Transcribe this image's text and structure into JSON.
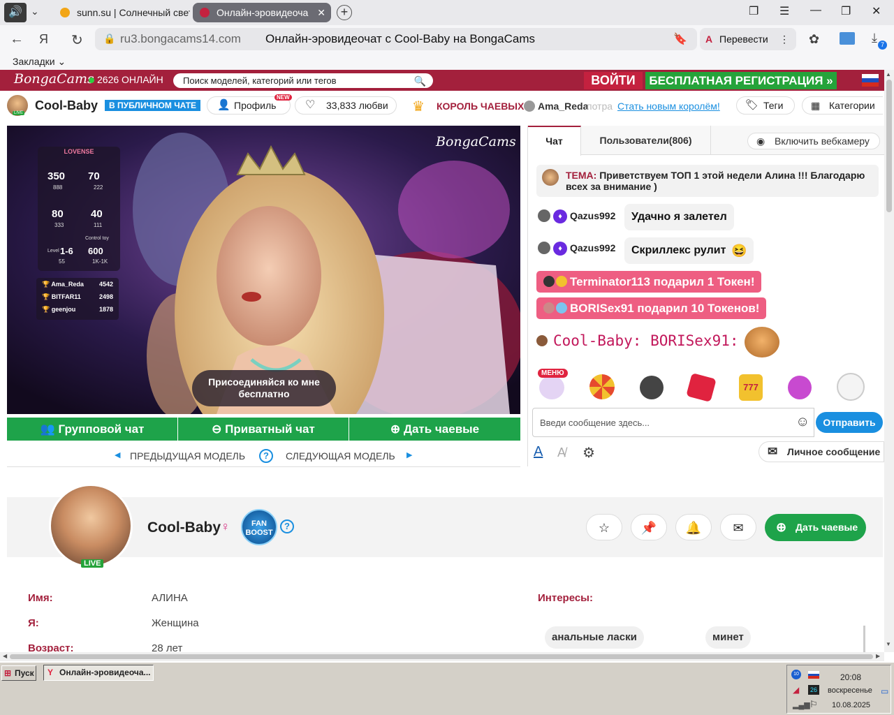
{
  "browser": {
    "tabs": [
      {
        "title": "sunn.su | Солнечный свет",
        "active": false
      },
      {
        "title": "Онлайн-эровидеоча",
        "active": true
      }
    ],
    "host": "ru3.bongacams14.com",
    "page_title": "Онлайн-эровидеочат с Cool-Baby на BongaCams",
    "translate_label": "Перевести",
    "bookmarks_label": "Закладки",
    "downloads_badge": "7"
  },
  "header": {
    "logo": "BongaCams",
    "online_text": "2626 ОНЛАЙН",
    "search_placeholder": "Поиск моделей, категорий или тегов",
    "login": "ВОЙТИ",
    "register": "БЕСПЛАТНАЯ РЕГИСТРАЦИЯ »"
  },
  "modelbar": {
    "name": "Cool-Baby",
    "status": "В ПУБЛИЧНОМ ЧАТЕ",
    "profile_label": "Профиль",
    "new_badge": "NEW",
    "love_count": "33,833 любви",
    "king_label": "КОРОЛЬ ЧАЕВЫХ:",
    "king_name": "Ama_Reda",
    "king_cut": "потра",
    "become_king": "Стать новым королём!",
    "tags_label": "Теги",
    "categories_label": "Категории",
    "live_badge": "LIVE"
  },
  "video": {
    "watermark": "BongaCams",
    "lovense_title": "LOVENSE",
    "lovense_stats": [
      {
        "value": "350",
        "sub": "888"
      },
      {
        "value": "70",
        "sub": "222"
      },
      {
        "value": "80",
        "sub": "333"
      },
      {
        "value": "40",
        "sub": "111"
      },
      {
        "value": "1-6",
        "label": "Level",
        "sub": "55"
      },
      {
        "value": "600",
        "label": "Control toy",
        "sub": "1K-1K"
      }
    ],
    "leaders": [
      {
        "name": "Ama_Reda",
        "value": "4542"
      },
      {
        "name": "BITFAR11",
        "value": "2498"
      },
      {
        "name": "geenjou",
        "value": "1878"
      }
    ],
    "join_prompt": "Присоединяйся ко мне бесплатно"
  },
  "actions": {
    "group_chat": "Групповой чат",
    "private_chat": "Приватный чат",
    "tip": "Дать чаевые",
    "prev_model": "ПРЕДЫДУЩАЯ МОДЕЛЬ",
    "next_model": "СЛЕДУЮЩАЯ МОДЕЛЬ",
    "help": "?"
  },
  "chat": {
    "tab_chat": "Чат",
    "tab_users": "Пользователи(806)",
    "webcam_btn": "Включить вебкамеру",
    "topic_label": "ТЕМА:",
    "topic_text": "Приветствуем ТОП 1 этой недели Алина !!! Благодарю всех за внимание )",
    "messages": [
      {
        "user": "Qazus992",
        "text": "Удачно я залетел"
      },
      {
        "user": "Qazus992",
        "text": "Скриллекс рулит"
      }
    ],
    "gifts": [
      "Terminator113 подарил 1 Токен!",
      "BORISex91 подарил 10 Токенов!"
    ],
    "model_message": "Cool-Baby: BORISex91:",
    "menu_badge": "МЕНЮ",
    "input_placeholder": "Введи сообщение здесь...",
    "send": "Отправить",
    "pm": "Личное сообщение"
  },
  "profile": {
    "name": "Cool-Baby",
    "live_badge": "LIVE",
    "fanboost": "FAN BOOST",
    "tip": "Дать чаевые",
    "fields": [
      {
        "label": "Имя:",
        "value": "АЛИНА"
      },
      {
        "label": "Я:",
        "value": "Женщина"
      },
      {
        "label": "Возраст:",
        "value": "28 лет"
      }
    ],
    "interests_label": "Интересы:",
    "interests": [
      "анальные ласки",
      "минет"
    ]
  },
  "taskbar": {
    "start": "Пуск",
    "task": "Онлайн-эровидеоча...",
    "time": "20:08",
    "day": "воскресенье",
    "date": "10.08.2025",
    "tray_badge": "10",
    "tray_num": "26"
  },
  "colors": {
    "brand": "#a3203c",
    "green": "#1ea34a",
    "send": "#1a8fe0",
    "gift": "#ee5e82"
  }
}
